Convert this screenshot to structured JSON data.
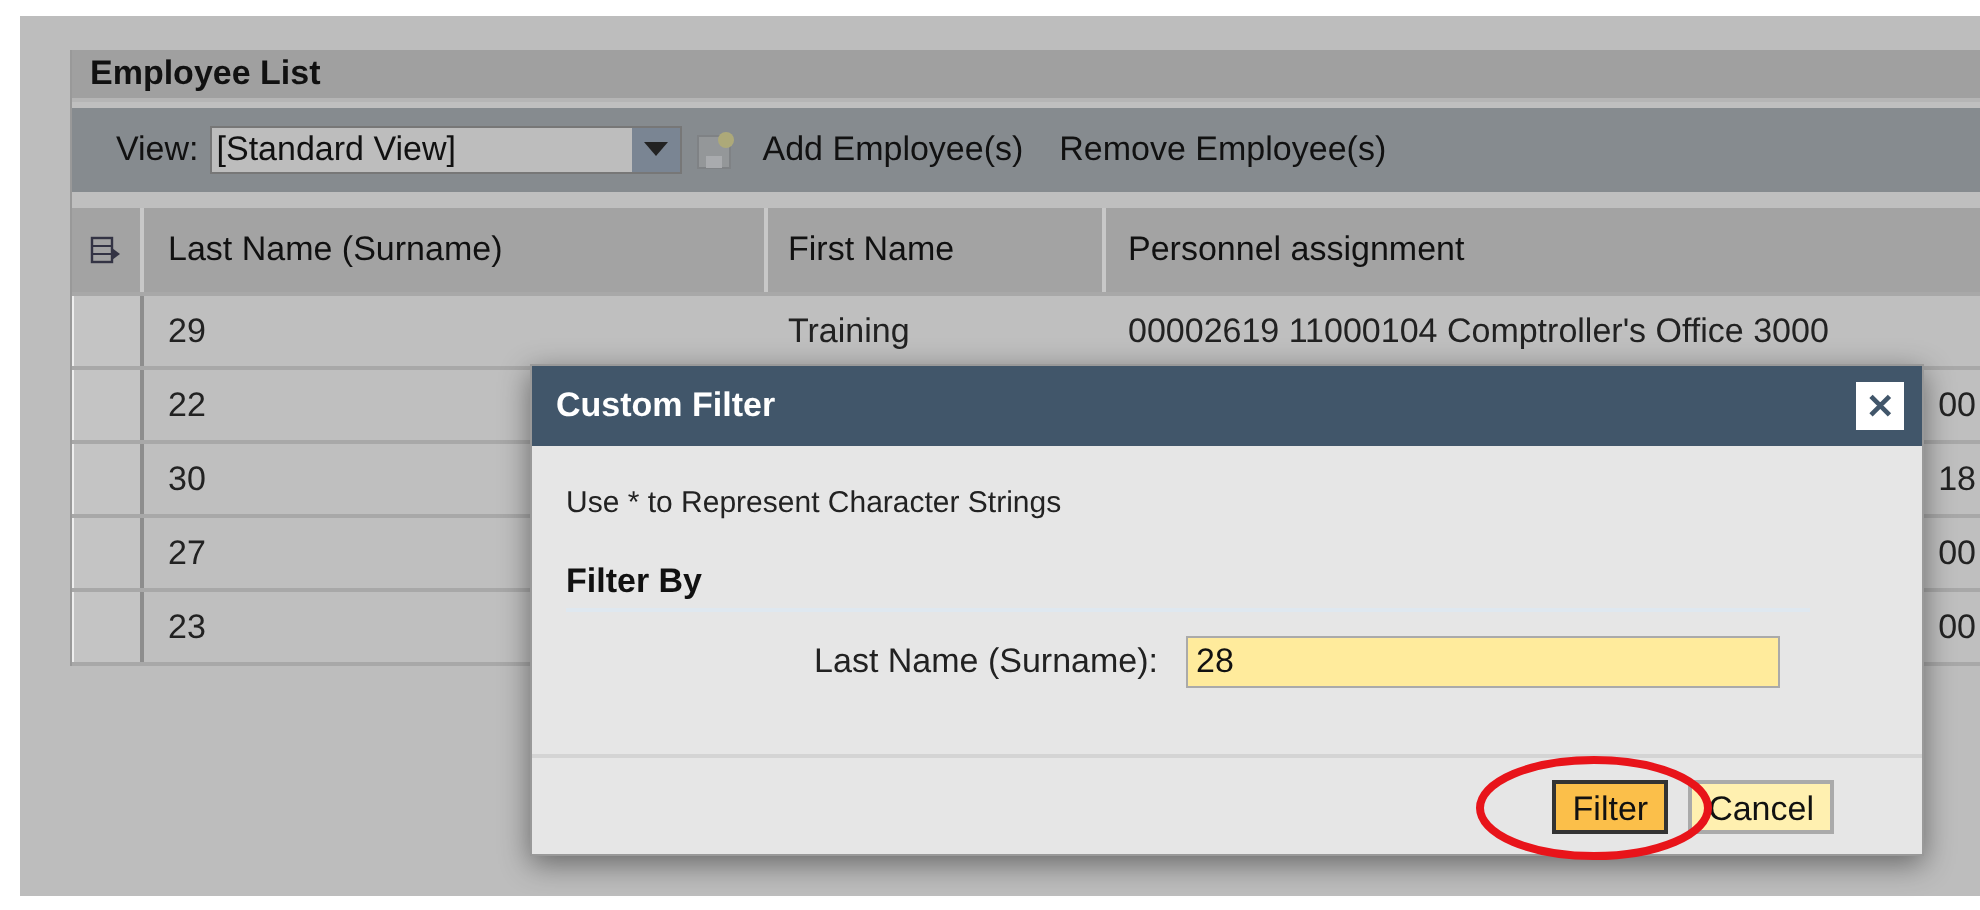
{
  "panel": {
    "title": "Employee List"
  },
  "toolbar": {
    "view_label": "View:",
    "view_value": "[Standard View]",
    "save_disabled": true,
    "actions": [
      "Add Employee(s)",
      "Remove Employee(s)"
    ]
  },
  "table": {
    "columns": [
      "Last Name (Surname)",
      "First Name",
      "Personnel assignment"
    ],
    "rows": [
      {
        "last_name": "29",
        "first_name": "Training",
        "personnel_assignment": "00002619 11000104 Comptroller's Office 3000"
      },
      {
        "last_name": "22",
        "personnel_assignment": "00"
      },
      {
        "last_name": "30",
        "personnel_assignment": "18"
      },
      {
        "last_name": "27",
        "personnel_assignment": "00"
      },
      {
        "last_name": "23",
        "personnel_assignment": "00"
      }
    ]
  },
  "dialog": {
    "title": "Custom Filter",
    "close": "✕",
    "hint": "Use * to Represent Character Strings",
    "section": "Filter By",
    "field_label": "Last Name (Surname):",
    "field_value": "28",
    "buttons": [
      {
        "label": "Filter",
        "kind": "primary"
      },
      {
        "label": "Cancel",
        "kind": "secondary"
      }
    ]
  }
}
